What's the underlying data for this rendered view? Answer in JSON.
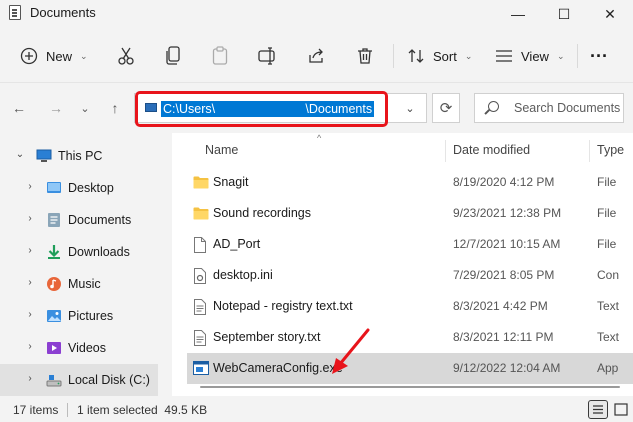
{
  "window": {
    "title": "Documents",
    "controls": {
      "minimize": "—",
      "maximize": "☐",
      "close": "✕"
    }
  },
  "toolbar": {
    "new_label": "New",
    "sort_label": "Sort",
    "view_label": "View",
    "more_label": "···",
    "icons": [
      "new-icon",
      "cut-icon",
      "copy-icon",
      "paste-icon",
      "rename-icon",
      "share-icon",
      "delete-icon",
      "sort-icon",
      "view-icon",
      "more-icon"
    ]
  },
  "nav": {
    "back": "←",
    "forward": "→",
    "recent": "⌄",
    "up": "↑",
    "address_path": "C:\\Users\\                          \\Documents",
    "search_placeholder": "Search Documents",
    "refresh": "⟳",
    "dropdown": "⌄"
  },
  "sidebar": {
    "items": [
      {
        "label": "This PC",
        "chevron": "⌄",
        "icon": "monitor-icon"
      },
      {
        "label": "Desktop",
        "chevron": "›",
        "icon": "desktop-folder-icon"
      },
      {
        "label": "Documents",
        "chevron": "›",
        "icon": "documents-folder-icon"
      },
      {
        "label": "Downloads",
        "chevron": "›",
        "icon": "downloads-folder-icon"
      },
      {
        "label": "Music",
        "chevron": "›",
        "icon": "music-folder-icon"
      },
      {
        "label": "Pictures",
        "chevron": "›",
        "icon": "pictures-folder-icon"
      },
      {
        "label": "Videos",
        "chevron": "›",
        "icon": "videos-folder-icon"
      },
      {
        "label": "Local Disk (C:)",
        "chevron": "›",
        "icon": "local-disk-icon"
      }
    ]
  },
  "columns": {
    "name": "Name",
    "date_modified": "Date modified",
    "type": "Type"
  },
  "sort_indicator": "^",
  "files": [
    {
      "name": "Snagit",
      "date": "8/19/2020 4:12 PM",
      "type": "File",
      "icon": "folder-icon"
    },
    {
      "name": "Sound recordings",
      "date": "9/23/2021 12:38 PM",
      "type": "File",
      "icon": "folder-icon"
    },
    {
      "name": "AD_Port",
      "date": "12/7/2021 10:15 AM",
      "type": "File",
      "icon": "file-icon"
    },
    {
      "name": "desktop.ini",
      "date": "7/29/2021 8:05 PM",
      "type": "Con",
      "icon": "settings-file-icon"
    },
    {
      "name": "Notepad - registry text.txt",
      "date": "8/3/2021 4:42 PM",
      "type": "Text",
      "icon": "text-file-icon"
    },
    {
      "name": "September story.txt",
      "date": "8/3/2021 12:11 PM",
      "type": "Text",
      "icon": "text-file-icon"
    },
    {
      "name": "WebCameraConfig.exe",
      "date": "9/12/2022 12:04 AM",
      "type": "App",
      "icon": "exe-file-icon",
      "selected": true
    }
  ],
  "status": {
    "item_count": "17 items",
    "selection": "1 item selected  49.5 KB"
  },
  "colors": {
    "highlight_border": "#e8141b",
    "selection_blue": "#0078d4",
    "folder_yellow": "#f5c242",
    "annotation_arrow": "#e8141b"
  }
}
